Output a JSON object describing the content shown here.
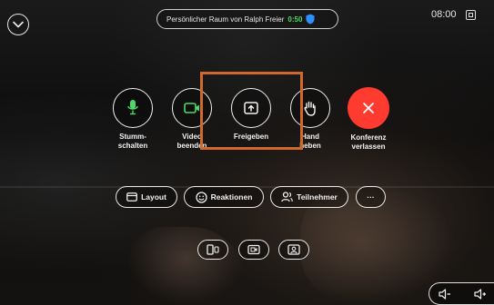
{
  "header": {
    "meeting_title": "Persönlicher Raum von Ralph Freier",
    "meeting_timer": "0:50",
    "clock": "08:00"
  },
  "controls": {
    "mute": {
      "label_line1": "Stumm-",
      "label_line2": "schalten"
    },
    "video": {
      "label_line1": "Video",
      "label_line2": "beenden"
    },
    "share": {
      "label": "Freigeben"
    },
    "raise_hand": {
      "label_line1": "Hand",
      "label_line2": "heben"
    },
    "leave": {
      "label_line1": "Konferenz",
      "label_line2": "verlassen"
    }
  },
  "toolbar": {
    "layout_label": "Layout",
    "reactions_label": "Reaktionen",
    "participants_label": "Teilnehmer",
    "more_label": "···"
  },
  "icons": {
    "collapse": "chevron-down-icon",
    "shield": "shield-icon",
    "mute": "microphone-icon",
    "video": "camera-icon",
    "share": "share-screen-icon",
    "raise_hand": "hand-icon",
    "leave": "close-icon",
    "layout": "layout-icon",
    "reactions": "smiley-icon",
    "participants": "participants-icon",
    "more": "more-icon",
    "camera_view": "camera-view-icon",
    "video_view": "video-view-icon",
    "self_view": "self-view-icon",
    "volume_down": "volume-down-icon",
    "volume_up": "volume-up-icon"
  },
  "colors": {
    "accent_green": "#4cd964",
    "leave_red": "#ff3b30",
    "highlight_orange": "#d0692a",
    "shield_blue": "#2f8fff"
  }
}
